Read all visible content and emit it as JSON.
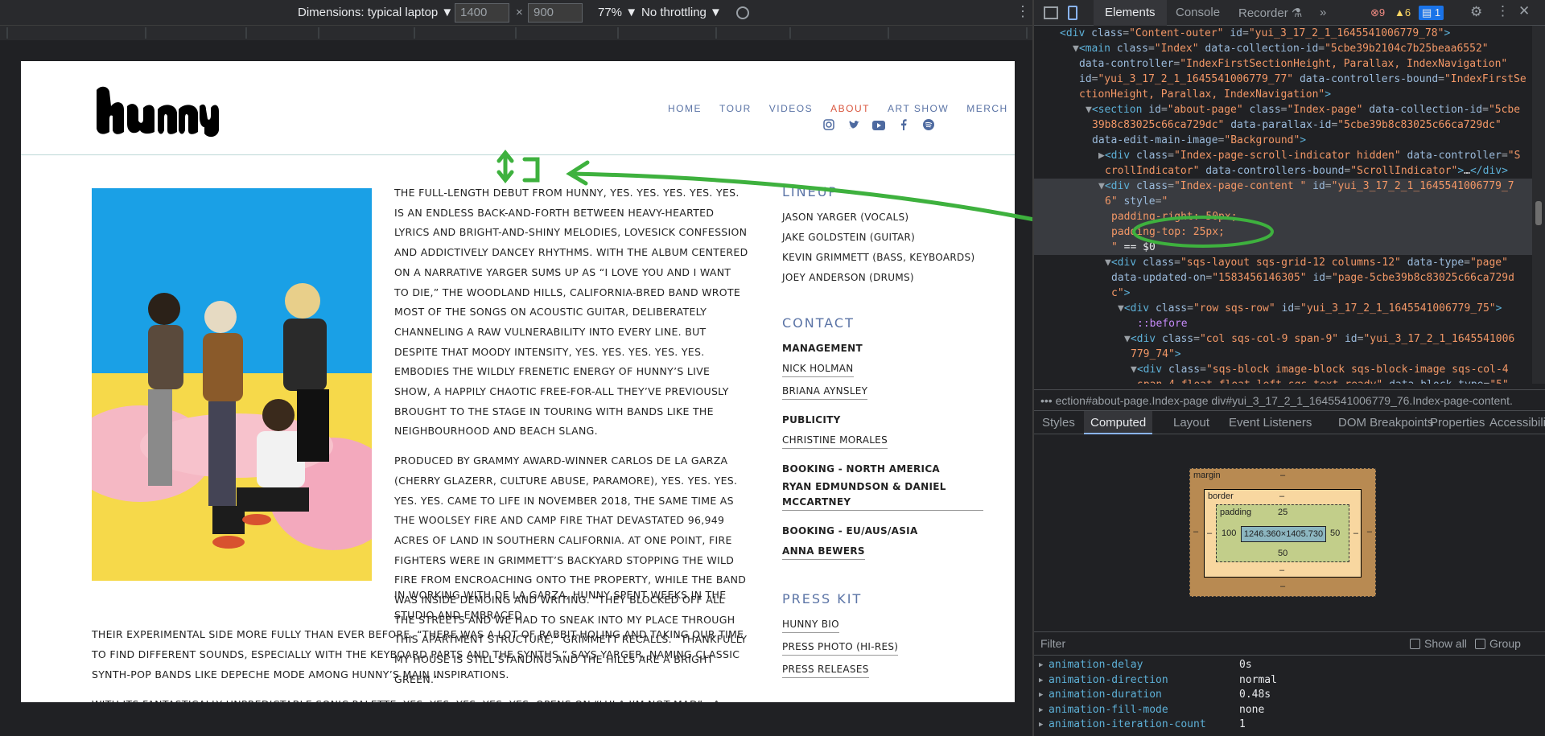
{
  "devbar": {
    "dimensions_label": "Dimensions: typical laptop ▼",
    "width_value": "1400",
    "height_value": "900",
    "times": "×",
    "zoom": "77% ▼",
    "throttling": "No throttling ▼"
  },
  "site": {
    "logo_text": "hunny",
    "nav": [
      {
        "label": "HOME",
        "active": false
      },
      {
        "label": "TOUR",
        "active": false
      },
      {
        "label": "VIDEOS",
        "active": false
      },
      {
        "label": "ABOUT",
        "active": true
      },
      {
        "label": "ART SHOW",
        "active": false
      },
      {
        "label": "MERCH",
        "active": false
      }
    ],
    "social_icons": [
      "instagram-icon",
      "twitter-icon",
      "youtube-icon",
      "facebook-icon",
      "spotify-icon"
    ],
    "para1": "THE FULL-LENGTH DEBUT FROM HUNNY, YES. YES. YES. YES. YES. IS AN ENDLESS BACK-AND-FORTH BETWEEN HEAVY-HEARTED LYRICS AND BRIGHT-AND-SHINY MELODIES, LOVESICK CONFESSION AND ADDICTIVELY DANCEY RHYTHMS. WITH THE ALBUM CENTERED ON A NARRATIVE YARGER SUMS UP AS “I LOVE YOU AND I WANT TO DIE,” THE WOODLAND HILLS, CALIFORNIA-BRED BAND WROTE MOST OF THE SONGS ON ACOUSTIC GUITAR, DELIBERATELY CHANNELING A RAW VULNERABILITY INTO EVERY LINE. BUT DESPITE THAT MOODY INTENSITY, YES. YES. YES. YES. YES. EMBODIES THE WILDLY FRENETIC ENERGY OF HUNNY’S LIVE SHOW, A HAPPILY CHAOTIC FREE-FOR-ALL THEY’VE PREVIOUSLY BROUGHT TO THE STAGE IN TOURING WITH BANDS LIKE THE NEIGHBOURHOOD AND BEACH SLANG.",
    "para2": "PRODUCED BY GRAMMY AWARD-WINNER CARLOS DE LA GARZA (CHERRY GLAZERR, CULTURE ABUSE, PARAMORE), YES. YES. YES. YES. YES. CAME TO LIFE IN NOVEMBER 2018, THE SAME TIME AS THE WOOLSEY FIRE AND CAMP FIRE THAT DEVASTATED 96,949 ACRES OF LAND IN SOUTHERN CALIFORNIA. AT ONE POINT, FIRE FIGHTERS WERE IN GRIMMETT’S BACKYARD STOPPING THE WILD FIRE FROM ENCROACHING ONTO THE PROPERTY, WHILE THE BAND WAS INSIDE DEMOING AND WRITING. “THEY BLOCKED OFF ALL THE STREETS AND WE HAD TO SNEAK INTO MY PLACE THROUGH THIS APARTMENT STRUCTURE,” GRIMMETT RECALLS. “THANKFULLY MY HOUSE IS STILL STANDING AND THE HILLS ARE A BRIGHT GREEN.”",
    "para3a": "IN WORKING WITH DE LA GARZA, HUNNY SPENT WEEKS IN THE STUDIO AND EMBRACED",
    "para3b": "THEIR EXPERIMENTAL SIDE MORE FULLY THAN EVER BEFORE. “THERE WAS A LOT OF RABBIT-HOLING AND TAKING OUR TIME TO FIND DIFFERENT SOUNDS, ESPECIALLY WITH THE KEYBOARD PARTS AND THE SYNTHS,” SAYS YARGER, NAMING CLASSIC SYNTH-POP BANDS LIKE DEPECHE MODE AMONG HUNNY’S MAIN INSPIRATIONS.",
    "para4": "WITH ITS FANTASTICALLY UNPREDICTABLE SONIC PALETTE, YES. YES. YES. YES. YES. OPENS ON “LULA I’M NOT MAD”—A BOUNCY POP TRACK THAT MATCHES ITS SHIMMERY SYNTH LINES WITH HOPELESSLY CRUSHED-OUT LYRICS. “IT’S ABOUT WHEN YOU’RE INFATUATED WITH SOMEONE, SO YOU JUST LET THEM DO WHATEVER",
    "lineup_title": "LINEUP",
    "lineup": [
      "JASON YARGER (VOCALS)",
      "JAKE GOLDSTEIN (GUITAR)",
      "KEVIN GRIMMETT (BASS, KEYBOARDS)",
      "JOEY ANDERSON (DRUMS)"
    ],
    "contact_title": "CONTACT",
    "management": "MANAGEMENT",
    "management_names": [
      "NICK HOLMAN",
      "BRIANA AYNSLEY"
    ],
    "publicity": "PUBLICITY",
    "publicity_name": "CHRISTINE MORALES",
    "booking_na": "BOOKING - NORTH AMERICA",
    "booking_na_name": "RYAN EDMUNDSON & DANIEL MCCARTNEY",
    "booking_eu": "BOOKING - EU/AUS/ASIA",
    "booking_eu_name": "ANNA BEWERS",
    "presskit_title": "PRESS KIT",
    "presskit": [
      "HUNNY BIO",
      "PRESS PHOTO (HI-RES)",
      "PRESS RELEASES"
    ]
  },
  "devtools": {
    "tabs": [
      "Elements",
      "Console",
      "Recorder ⚗",
      "»"
    ],
    "errors": "9",
    "warnings": "6",
    "messages": "1",
    "breadcrumb": "••• ection#about-page.Index-page   div#yui_3_17_2_1_1645541006779_76.Index-page-content.",
    "panel_tabs": [
      "Styles",
      "Computed",
      "Layout",
      "Event Listeners",
      "DOM Breakpoints",
      "Properties",
      "Accessibility"
    ],
    "box": {
      "margin_label": "margin",
      "border_label": "border",
      "padding_label": "padding",
      "dash": "–",
      "pad_top": "25",
      "pad_right": "50",
      "pad_bottom": "50",
      "pad_left": "100",
      "content": "1246.360×1405.730"
    },
    "filter_placeholder": "Filter",
    "show_all": "Show all",
    "group": "Group",
    "props": [
      {
        "k": "animation-delay",
        "v": "0s"
      },
      {
        "k": "animation-direction",
        "v": "normal"
      },
      {
        "k": "animation-duration",
        "v": "0.48s"
      },
      {
        "k": "animation-fill-mode",
        "v": "none"
      },
      {
        "k": "animation-iteration-count",
        "v": "1"
      }
    ],
    "tree": [
      {
        "indent": 4,
        "html": "<span class='tag'>&lt;div</span> <span class='an'>class</span>=<span class='av'>\"Content-outer\"</span> <span class='an'>id</span>=<span class='av'>\"yui_3_17_2_1_1645541006779_78\"</span><span class='tag'>&gt;</span>"
      },
      {
        "indent": 6,
        "html": "▼<span class='tag'>&lt;main</span> <span class='an'>class</span>=<span class='av'>\"Index\"</span> <span class='an'>data-collection-id</span>=<span class='av'>\"5cbe39b2104c7b25beaa6552\"</span>"
      },
      {
        "indent": 7,
        "html": "<span class='an'>data-controller</span>=<span class='av'>\"IndexFirstSectionHeight, Parallax, IndexNavigation\"</span>"
      },
      {
        "indent": 7,
        "html": "<span class='an'>id</span>=<span class='av'>\"yui_3_17_2_1_1645541006779_77\"</span> <span class='an'>data-controllers-bound</span>=<span class='av'>\"IndexFirstSe</span>"
      },
      {
        "indent": 7,
        "html": "<span class='av'>ctionHeight, Parallax, IndexNavigation\"</span><span class='tag'>&gt;</span>"
      },
      {
        "indent": 8,
        "html": "▼<span class='tag'>&lt;section</span> <span class='an'>id</span>=<span class='av'>\"about-page\"</span> <span class='an'>class</span>=<span class='av'>\"Index-page\"</span> <span class='an'>data-collection-id</span>=<span class='av'>\"5cbe</span>"
      },
      {
        "indent": 9,
        "html": "<span class='av'>39b8c83025c66ca729dc\"</span> <span class='an'>data-parallax-id</span>=<span class='av'>\"5cbe39b8c83025c66ca729dc\"</span>"
      },
      {
        "indent": 9,
        "html": "<span class='an'>data-edit-main-image</span>=<span class='av'>\"Background\"</span><span class='tag'>&gt;</span>"
      },
      {
        "indent": 10,
        "html": "▶<span class='tag'>&lt;div</span> <span class='an'>class</span>=<span class='av'>\"Index-page-scroll-indicator hidden\"</span> <span class='an'>data-controller</span>=<span class='av'>\"S</span>"
      },
      {
        "indent": 11,
        "html": "<span class='av'>crollIndicator\"</span> <span class='an'>data-controllers-bound</span>=<span class='av'>\"ScrollIndicator\"</span><span class='tag'>&gt;</span><span class='tx'>…</span><span class='tag'>&lt;/div&gt;</span>"
      },
      {
        "indent": 10,
        "sel": true,
        "html": "▼<span class='tag'>&lt;div</span> <span class='an'>class</span>=<span class='av'>\"Index-page-content \"</span> <span class='an'>id</span>=<span class='av'>\"yui_3_17_2_1_1645541006779_7</span>"
      },
      {
        "indent": 11,
        "sel": true,
        "html": "<span class='av'>6\"</span> <span class='an'>style</span>=<span class='av'>\"</span>"
      },
      {
        "indent": 12,
        "sel": true,
        "html": "<span class='av'>padding-right: 50px;</span>"
      },
      {
        "indent": 12,
        "sel": true,
        "html": "<span class='av'>padding-top: 25px;</span>"
      },
      {
        "indent": 12,
        "sel": true,
        "html": "<span class='av'>\"</span><span class='tx'> == $0</span>"
      },
      {
        "indent": 11,
        "html": "▼<span class='tag'>&lt;div</span> <span class='an'>class</span>=<span class='av'>\"sqs-layout sqs-grid-12 columns-12\"</span> <span class='an'>data-type</span>=<span class='av'>\"page\"</span>"
      },
      {
        "indent": 12,
        "html": "<span class='an'>data-updated-on</span>=<span class='av'>\"1583456146305\"</span> <span class='an'>id</span>=<span class='av'>\"page-5cbe39b8c83025c66ca729d</span>"
      },
      {
        "indent": 12,
        "html": "<span class='av'>c\"</span><span class='tag'>&gt;</span>"
      },
      {
        "indent": 13,
        "html": "▼<span class='tag'>&lt;div</span> <span class='an'>class</span>=<span class='av'>\"row sqs-row\"</span> <span class='an'>id</span>=<span class='av'>\"yui_3_17_2_1_1645541006779_75\"</span><span class='tag'>&gt;</span>"
      },
      {
        "indent": 16,
        "html": "<span style='color:#c58af9'>::before</span>"
      },
      {
        "indent": 14,
        "html": "▼<span class='tag'>&lt;div</span> <span class='an'>class</span>=<span class='av'>\"col sqs-col-9 span-9\"</span> <span class='an'>id</span>=<span class='av'>\"yui_3_17_2_1_1645541006</span>"
      },
      {
        "indent": 15,
        "html": "<span class='av'>779_74\"</span><span class='tag'>&gt;</span>"
      },
      {
        "indent": 15,
        "html": "▼<span class='tag'>&lt;div</span> <span class='an'>class</span>=<span class='av'>\"sqs-block image-block sqs-block-image sqs-col-4</span>"
      },
      {
        "indent": 16,
        "html": "<span class='av'>span-4 float float-left sqs-text-ready\"</span> <span class='an'>data-block-type</span>=<span class='av'>\"5\"</span>"
      }
    ]
  }
}
